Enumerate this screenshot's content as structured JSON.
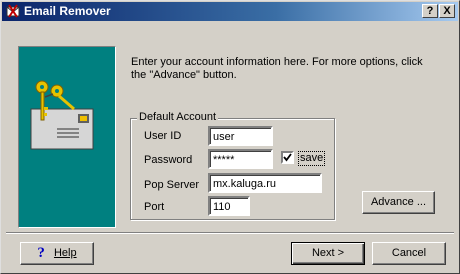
{
  "window": {
    "title": "Email Remover",
    "help_glyph": "?",
    "close_glyph": "X"
  },
  "description": "Enter your account information here.   For more options, click the \"Advance\" button.",
  "account": {
    "group_label": "Default Account",
    "user_id_label": "User ID",
    "user_id_value": "user",
    "password_label": "Password",
    "password_value": "*****",
    "save_label": "save",
    "save_checked": true,
    "pop_server_label": "Pop Server",
    "pop_server_value": "mx.kaluga.ru",
    "port_label": "Port",
    "port_value": "110"
  },
  "buttons": {
    "advance": "Advance ...",
    "help": "Help",
    "next": "Next >",
    "cancel": "Cancel"
  },
  "colors": {
    "illustration_bg": "#008080",
    "titlebar_start": "#0a246a",
    "titlebar_end": "#a6caf0"
  },
  "icons": [
    "app-icon",
    "keys-icon",
    "envelope-icon",
    "help-question-icon",
    "checkmark-icon"
  ]
}
